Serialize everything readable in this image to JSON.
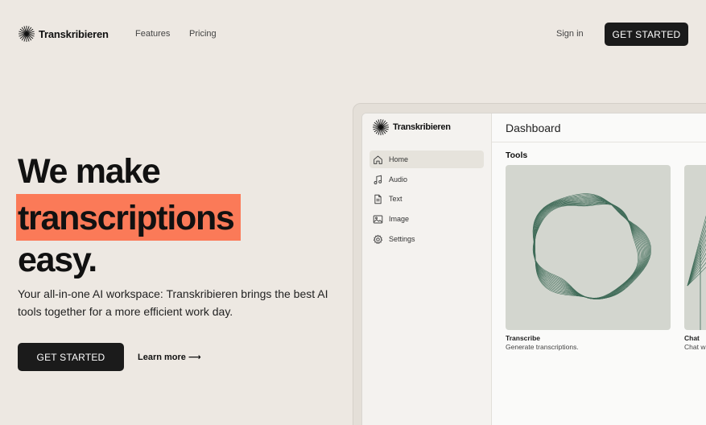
{
  "brand": {
    "name": "Transkribieren"
  },
  "nav": {
    "features": "Features",
    "pricing": "Pricing",
    "sign_in": "Sign in",
    "cta": "GET STARTED"
  },
  "hero": {
    "headline_1": "We make",
    "headline_highlight": "transcriptions",
    "headline_3": "easy.",
    "subtitle": "Your all-in-one AI workspace: Transkribieren brings the best AI tools together for a more efficient work day.",
    "cta": "GET STARTED",
    "learn_more": "Learn more ⟶"
  },
  "app": {
    "brand": "Transkribieren",
    "sidebar": [
      {
        "label": "Home",
        "icon": "home-icon",
        "active": true
      },
      {
        "label": "Audio",
        "icon": "music-note-icon",
        "active": false
      },
      {
        "label": "Text",
        "icon": "document-icon",
        "active": false
      },
      {
        "label": "Image",
        "icon": "image-icon",
        "active": false
      },
      {
        "label": "Settings",
        "icon": "gear-icon",
        "active": false
      }
    ],
    "title": "Dashboard",
    "section_title": "Tools",
    "cards": [
      {
        "title": "Transcribe",
        "description": "Generate transcriptions."
      },
      {
        "title": "Chat",
        "description": "Chat w"
      }
    ]
  },
  "colors": {
    "background": "#ede8e2",
    "highlight": "#fb7a58",
    "button": "#1b1b1b",
    "card": "#d3d6cf",
    "line_art": "#3f6b58"
  }
}
